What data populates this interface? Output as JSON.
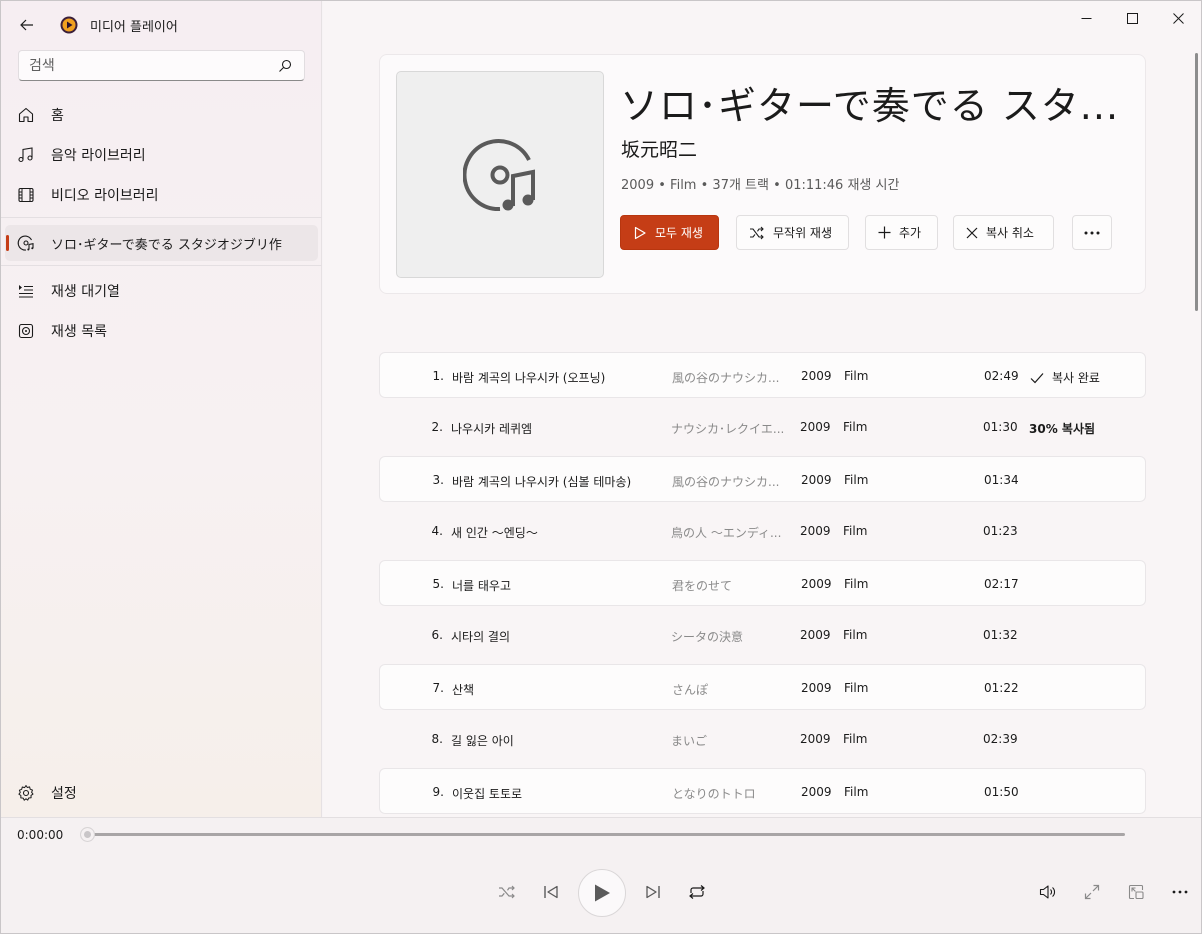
{
  "app": {
    "title": "미디어 플레이어"
  },
  "search": {
    "placeholder": "검색"
  },
  "sidebar": {
    "items": [
      {
        "label": "홈",
        "icon": "home-icon"
      },
      {
        "label": "음악 라이브러리",
        "icon": "music-note-icon"
      },
      {
        "label": "비디오 라이브러리",
        "icon": "film-icon"
      },
      {
        "label": "ソロ･ギターで奏でる スタジオジブリ作",
        "icon": "album-icon"
      },
      {
        "label": "재생 대기열",
        "icon": "queue-icon"
      },
      {
        "label": "재생 목록",
        "icon": "playlist-icon"
      }
    ],
    "settings_label": "설정"
  },
  "album": {
    "title": "ソロ･ギターで奏でる スタ...",
    "artist": "坂元昭二",
    "year": "2009",
    "genre": "Film",
    "track_count": "37개 트랙",
    "duration": "01:11:46 재생 시간",
    "sep": "•"
  },
  "actions": {
    "play_all": "모두 재생",
    "shuffle": "무작위 재생",
    "add": "추가",
    "cancel_copy": "복사 취소",
    "more": "..."
  },
  "tracks": [
    {
      "num": "1.",
      "title": "바람 계곡의 나우시카 (오프닝)",
      "album": "風の谷のナウシカ...",
      "year": "2009",
      "genre": "Film",
      "duration": "02:49",
      "status": "복사 완료"
    },
    {
      "num": "2.",
      "title": "나우시카 레퀴엠",
      "album": "ナウシカ･レクイエ...",
      "year": "2009",
      "genre": "Film",
      "duration": "01:30",
      "status": "30% 복사됨"
    },
    {
      "num": "3.",
      "title": "바람 계곡의 나우시카 (심볼 테마송)",
      "album": "風の谷のナウシカ...",
      "year": "2009",
      "genre": "Film",
      "duration": "01:34",
      "status": ""
    },
    {
      "num": "4.",
      "title": "새 인간 ～엔딩～",
      "album": "鳥の人 ～エンディ...",
      "year": "2009",
      "genre": "Film",
      "duration": "01:23",
      "status": ""
    },
    {
      "num": "5.",
      "title": "너를 태우고",
      "album": "君をのせて",
      "year": "2009",
      "genre": "Film",
      "duration": "02:17",
      "status": ""
    },
    {
      "num": "6.",
      "title": "시타의 결의",
      "album": "シータの決意",
      "year": "2009",
      "genre": "Film",
      "duration": "01:32",
      "status": ""
    },
    {
      "num": "7.",
      "title": "산책",
      "album": "さんぽ",
      "year": "2009",
      "genre": "Film",
      "duration": "01:22",
      "status": ""
    },
    {
      "num": "8.",
      "title": "길 잃은 아이",
      "album": "まいご",
      "year": "2009",
      "genre": "Film",
      "duration": "02:39",
      "status": ""
    },
    {
      "num": "9.",
      "title": "이웃집 토토로",
      "album": "となりのトトロ",
      "year": "2009",
      "genre": "Film",
      "duration": "01:50",
      "status": ""
    }
  ],
  "player": {
    "current_time": "0:00:00",
    "progress": 0
  },
  "colors": {
    "accent": "#c53d16"
  }
}
